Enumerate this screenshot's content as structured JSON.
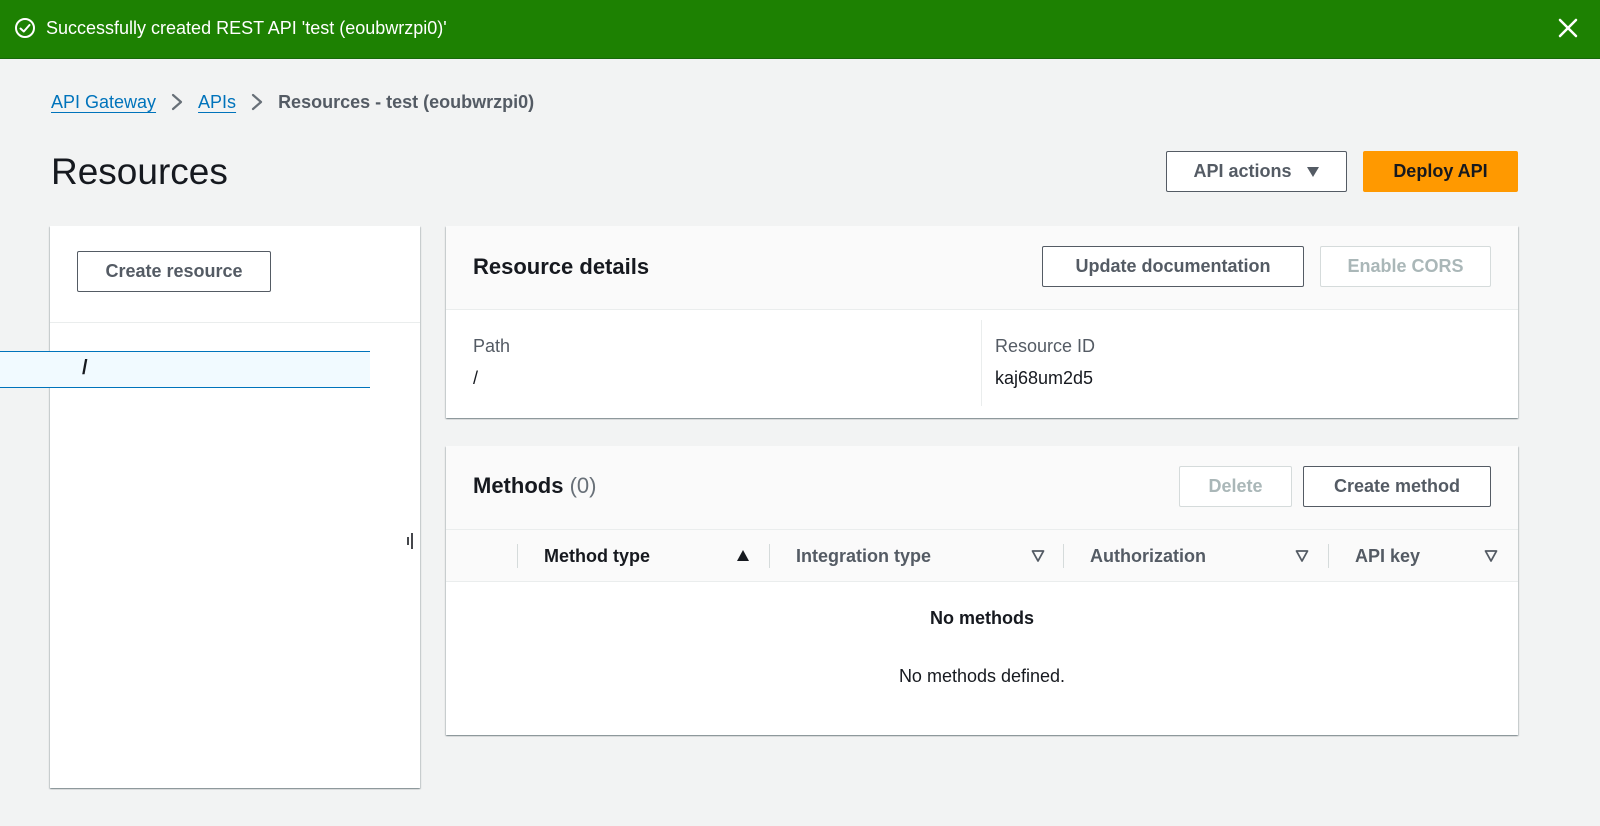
{
  "flash": {
    "message": "Successfully created REST API 'test (eoubwrzpi0)'",
    "status_icon": "check-circle-icon",
    "close_icon": "close-icon",
    "color": "#1d8102"
  },
  "breadcrumb": {
    "items": [
      "API Gateway",
      "APIs"
    ],
    "current": "Resources - test (eoubwrzpi0)"
  },
  "page": {
    "title": "Resources"
  },
  "header_actions": {
    "api_actions_label": "API actions",
    "deploy_label": "Deploy API",
    "deploy_color": "#ff9900"
  },
  "resource_tree": {
    "create_resource_label": "Create resource",
    "items": [
      {
        "label": "/",
        "selected": true
      }
    ]
  },
  "resource_details": {
    "title": "Resource details",
    "update_documentation_label": "Update documentation",
    "enable_cors_label": "Enable CORS",
    "path_label": "Path",
    "path_value": "/",
    "resource_id_label": "Resource ID",
    "resource_id_value": "kaj68um2d5"
  },
  "methods": {
    "title": "Methods",
    "count": "(0)",
    "delete_label": "Delete",
    "create_method_label": "Create method",
    "columns": [
      "Method type",
      "Integration type",
      "Authorization",
      "API key"
    ],
    "sort_column": "Method type",
    "empty_title": "No methods",
    "empty_text": "No methods defined."
  }
}
